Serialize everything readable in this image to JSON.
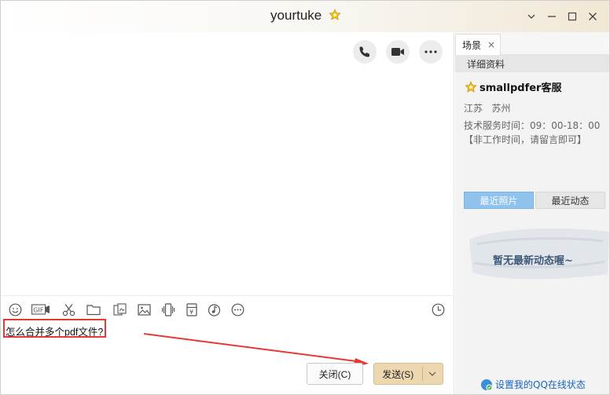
{
  "window": {
    "title": "yourtuke",
    "buttons": [
      "chevron-down-icon",
      "minimize-icon",
      "maximize-icon",
      "close-icon"
    ]
  },
  "chat": {
    "call_buttons": [
      "phone-icon",
      "video-icon",
      "more-icon"
    ],
    "toolbar_icons": [
      "emoji-icon",
      "gif-icon",
      "scissors-icon",
      "folder-icon",
      "image-sticker-icon",
      "picture-icon",
      "vibrate-icon",
      "red-packet-icon",
      "music-icon",
      "more-tools-icon",
      "history-clock-icon"
    ],
    "gif_label": "GIF",
    "money_label": "¥",
    "input_text": "怎么合并多个pdf文件?",
    "close_button": "关闭(C)",
    "send_button": "发送(S)"
  },
  "side": {
    "tab_label": "场景",
    "tab_close": "×",
    "section_title": "详细资料",
    "contact_name": "smallpdfer客服",
    "location": "江苏   苏州",
    "hours": "技术服务时间：09：00-18：00【非工作时间，请留言即可】",
    "tabs": [
      "最近照片",
      "最近动态"
    ],
    "empty_text": "暂无最新动态喔~",
    "status_link": "设置我的QQ在线状态"
  },
  "colors": {
    "accent_send": "#ecd7b0",
    "annotation_red": "#e53935",
    "tab_active": "#8fc2ec"
  }
}
